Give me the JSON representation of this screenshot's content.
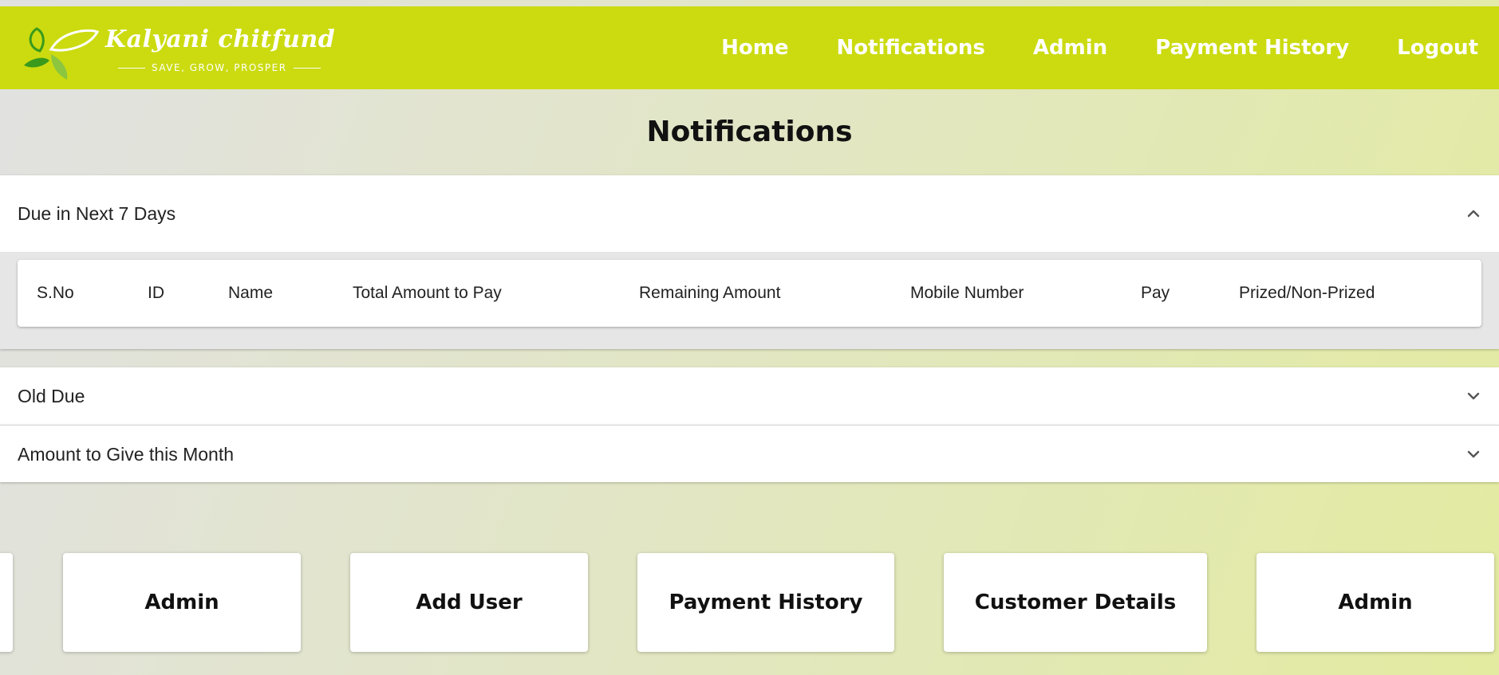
{
  "brand": {
    "name": "Kalyani chitfund",
    "tagline": "SAVE, GROW, PROSPER",
    "colors": {
      "primary": "#cbdb10",
      "leaf_dark": "#3a9a1c",
      "leaf_light": "#8cc63f"
    }
  },
  "nav": {
    "items": [
      {
        "label": "Home"
      },
      {
        "label": "Notifications"
      },
      {
        "label": "Admin"
      },
      {
        "label": "Payment History"
      },
      {
        "label": "Logout"
      }
    ]
  },
  "page": {
    "title": "Notifications"
  },
  "sections": [
    {
      "title": "Due in Next 7 Days",
      "expanded": true,
      "icon": "chevron-up-icon",
      "table": {
        "columns": [
          "S.No",
          "ID",
          "Name",
          "Total Amount to Pay",
          "Remaining Amount",
          "Mobile Number",
          "Pay",
          "Prized/Non-Prized"
        ]
      }
    },
    {
      "title": "Old Due",
      "expanded": false,
      "icon": "chevron-down-icon"
    },
    {
      "title": "Amount to Give this Month",
      "expanded": false,
      "icon": "chevron-down-icon"
    }
  ],
  "cards": [
    {
      "label": ""
    },
    {
      "label": "Admin"
    },
    {
      "label": "Add User"
    },
    {
      "label": "Payment History"
    },
    {
      "label": "Customer Details"
    },
    {
      "label": "Admin"
    }
  ]
}
